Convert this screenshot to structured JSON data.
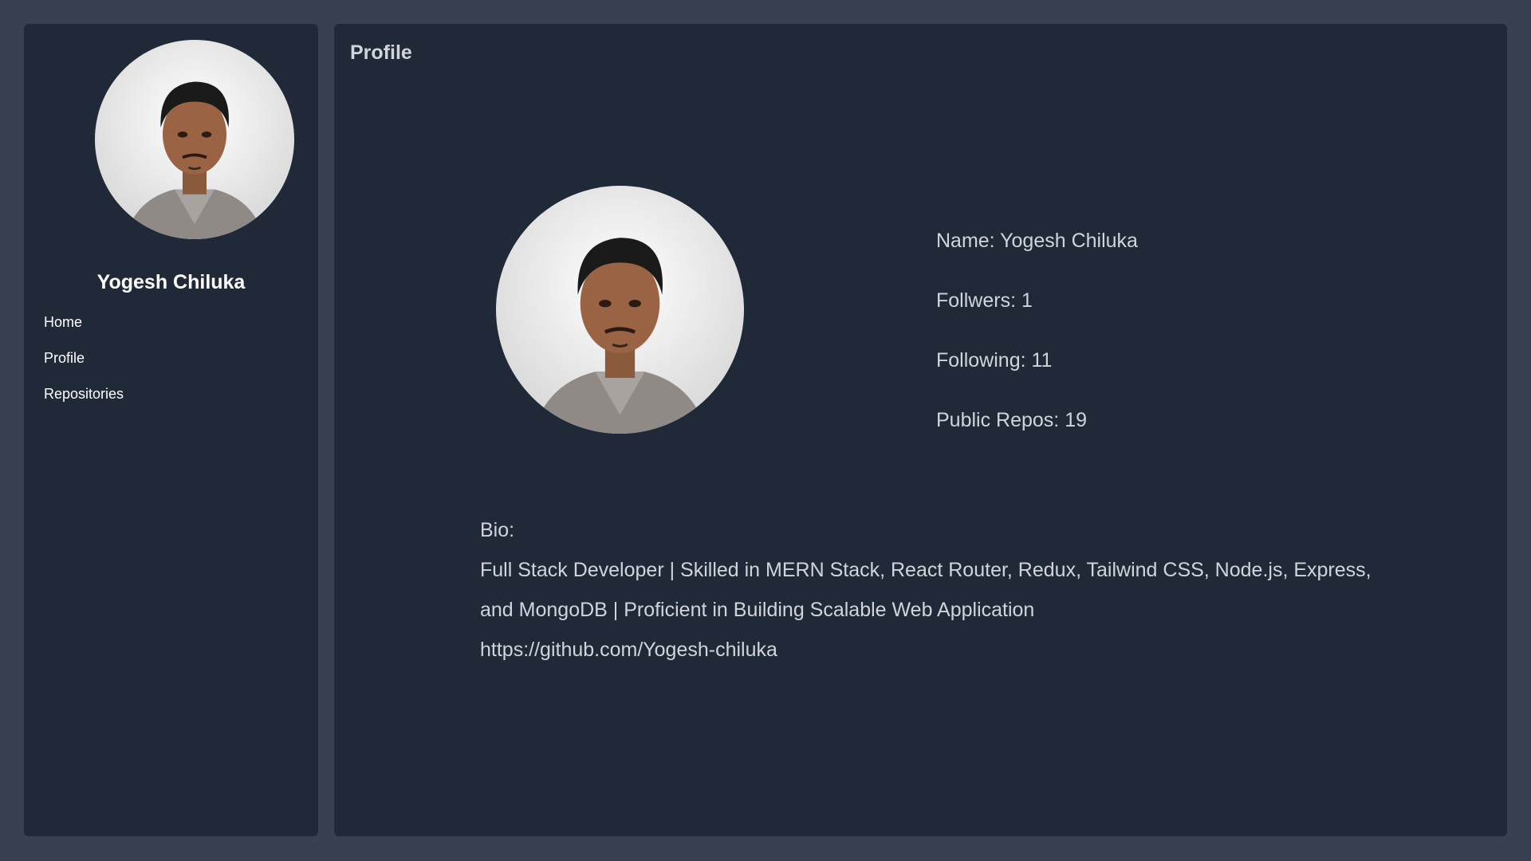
{
  "sidebar": {
    "user_name": "Yogesh Chiluka",
    "nav": [
      {
        "label": "Home"
      },
      {
        "label": "Profile"
      },
      {
        "label": "Repositories"
      }
    ]
  },
  "main": {
    "title": "Profile",
    "stats": {
      "name": "Name: Yogesh Chiluka",
      "followers": "Follwers: 1",
      "following": "Following: 11",
      "repos": "Public Repos: 19"
    },
    "bio": {
      "label": "Bio:",
      "text": "Full Stack Developer | Skilled in MERN Stack, React Router, Redux, Tailwind CSS, Node.js, Express, and MongoDB | Proficient in Building Scalable Web Application",
      "link": "https://github.com/Yogesh-chiluka"
    }
  },
  "colors": {
    "page_bg": "#374151",
    "panel_bg": "#1f2937",
    "text": "#d1d5db",
    "heading": "#ffffff"
  }
}
